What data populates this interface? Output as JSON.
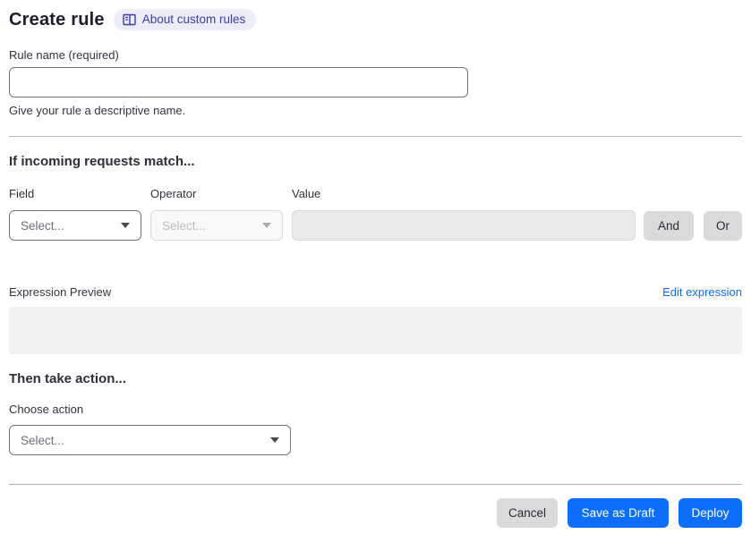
{
  "header": {
    "title": "Create rule",
    "about_link_label": "About custom rules"
  },
  "rule_name": {
    "label": "Rule name (required)",
    "value": "",
    "helper": "Give your rule a descriptive name."
  },
  "match_section": {
    "heading": "If incoming requests match...",
    "field": {
      "label": "Field",
      "selected": "Select..."
    },
    "operator": {
      "label": "Operator",
      "selected": "Select..."
    },
    "value": {
      "label": "Value",
      "value": ""
    },
    "and_button_label": "And",
    "or_button_label": "Or",
    "expression_preview_label": "Expression Preview",
    "edit_expression_label": "Edit expression",
    "expression_value": ""
  },
  "action_section": {
    "heading": "Then take action...",
    "choose_label": "Choose action",
    "selected": "Select..."
  },
  "footer": {
    "cancel_label": "Cancel",
    "save_draft_label": "Save as Draft",
    "deploy_label": "Deploy"
  },
  "icons": {
    "about_icon": "book-icon",
    "select_icon": "chevron-down-icon"
  },
  "colors": {
    "primary_blue": "#0d6efd",
    "link_blue": "#0d6efd",
    "badge_background": "#edecf9",
    "badge_text": "#3c3cae",
    "gray_button": "#dadadb",
    "disabled_fill": "#ebebec",
    "preview_fill": "#f1f1f2"
  }
}
